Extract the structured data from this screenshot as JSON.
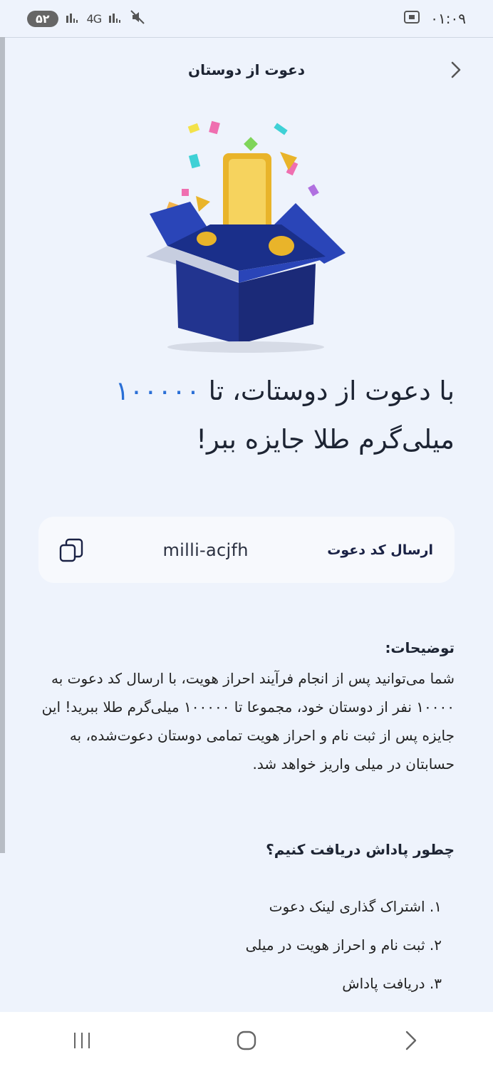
{
  "status_bar": {
    "battery": "۵۲",
    "network": "4G",
    "time": "۰۱:۰۹"
  },
  "header": {
    "title": "دعوت از دوستان"
  },
  "hero": {
    "box_color": "#1e3a9a",
    "gold_color": "#e9b42a"
  },
  "headline": {
    "part1": "با دعوت از دوستات، تا ",
    "amount": "۱۰۰۰۰۰",
    "part2": " میلی‌گرم طلا جایزه ببر!",
    "accent_color": "#2a6fd6"
  },
  "invite": {
    "code": "milli-acjfh",
    "send_label": "ارسال کد دعوت"
  },
  "description": {
    "title": "توضیحات:",
    "body": "شما می‌توانید پس از انجام فرآیند احراز هویت، با ارسال کد دعوت به ۱۰۰۰۰ نفر از دوستان خود، مجموعا تا ۱۰۰۰۰۰ میلی‌گرم طلا ببرید! این جایزه پس از ثبت نام و احراز هویت تمامی دوستان دعوت‌شده، به حسابتان در میلی واریز خواهد شد."
  },
  "how": {
    "title": "چطور پاداش دریافت کنیم؟",
    "steps": [
      "۱. اشتراک گذاری لینک دعوت",
      "۲. ثبت نام و احراز هویت در میلی",
      "۳. دریافت پاداش"
    ]
  }
}
